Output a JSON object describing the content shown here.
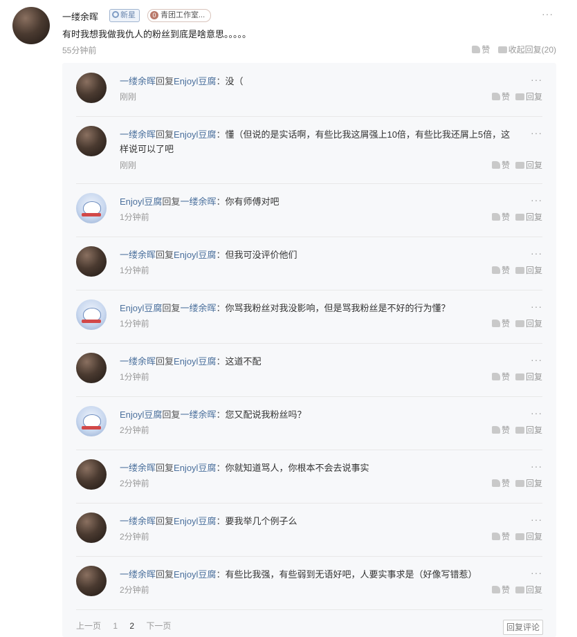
{
  "root": {
    "username": "一缕余晖",
    "badge_new": "新星",
    "badge_studio_num": "0",
    "badge_studio": "青团工作室...",
    "more": "···",
    "content": "有时我想我做我仇人的粉丝到底是啥意思。。。。。",
    "time": "55分钟前",
    "like_label": "赞",
    "collapse_label": "收起回复(20)"
  },
  "replies": [
    {
      "from": "一缕余晖",
      "verb": "回复",
      "to": "Enjoyl豆腐",
      "sep": "：",
      "text": "没（",
      "time": "刚刚",
      "avatar": "dark"
    },
    {
      "from": "一缕余晖",
      "verb": "回复",
      "to": "Enjoyl豆腐",
      "sep": "：",
      "text": "懂（但说的是实话啊，有些比我这屑强上10倍，有些比我还屑上5倍，这样说可以了吧",
      "time": "刚刚",
      "avatar": "dark"
    },
    {
      "from": "Enjoyl豆腐",
      "verb": "回复",
      "to": "一缕余晖",
      "sep": "：",
      "text": "你有师傅对吧",
      "time": "1分钟前",
      "avatar": "cartoon"
    },
    {
      "from": "一缕余晖",
      "verb": "回复",
      "to": "Enjoyl豆腐",
      "sep": "：",
      "text": "但我可没评价他们",
      "time": "1分钟前",
      "avatar": "dark"
    },
    {
      "from": "Enjoyl豆腐",
      "verb": "回复",
      "to": "一缕余晖",
      "sep": "：",
      "text": "你骂我粉丝对我没影响，但是骂我粉丝是不好的行为懂？",
      "time": "1分钟前",
      "avatar": "cartoon"
    },
    {
      "from": "一缕余晖",
      "verb": "回复",
      "to": "Enjoyl豆腐",
      "sep": "：",
      "text": "这道不配",
      "time": "1分钟前",
      "avatar": "dark"
    },
    {
      "from": "Enjoyl豆腐",
      "verb": "回复",
      "to": "一缕余晖",
      "sep": "：",
      "text": "您又配说我粉丝吗？",
      "time": "2分钟前",
      "avatar": "cartoon"
    },
    {
      "from": "一缕余晖",
      "verb": "回复",
      "to": "Enjoyl豆腐",
      "sep": "：",
      "text": "你就知道骂人，你根本不会去说事实",
      "time": "2分钟前",
      "avatar": "dark"
    },
    {
      "from": "一缕余晖",
      "verb": "回复",
      "to": "Enjoyl豆腐",
      "sep": "：",
      "text": "要我举几个例子么",
      "time": "2分钟前",
      "avatar": "dark"
    },
    {
      "from": "一缕余晖",
      "verb": "回复",
      "to": "Enjoyl豆腐",
      "sep": "：",
      "text": "有些比我强，有些弱到无语好吧，人要实事求是（好像写错惹）",
      "time": "2分钟前",
      "avatar": "dark"
    }
  ],
  "reply_actions": {
    "like": "赞",
    "reply": "回复",
    "more": "···"
  },
  "pager": {
    "prev": "上一页",
    "page1": "1",
    "page2": "2",
    "next": "下一页"
  },
  "reply_comment_button": "回复评论"
}
